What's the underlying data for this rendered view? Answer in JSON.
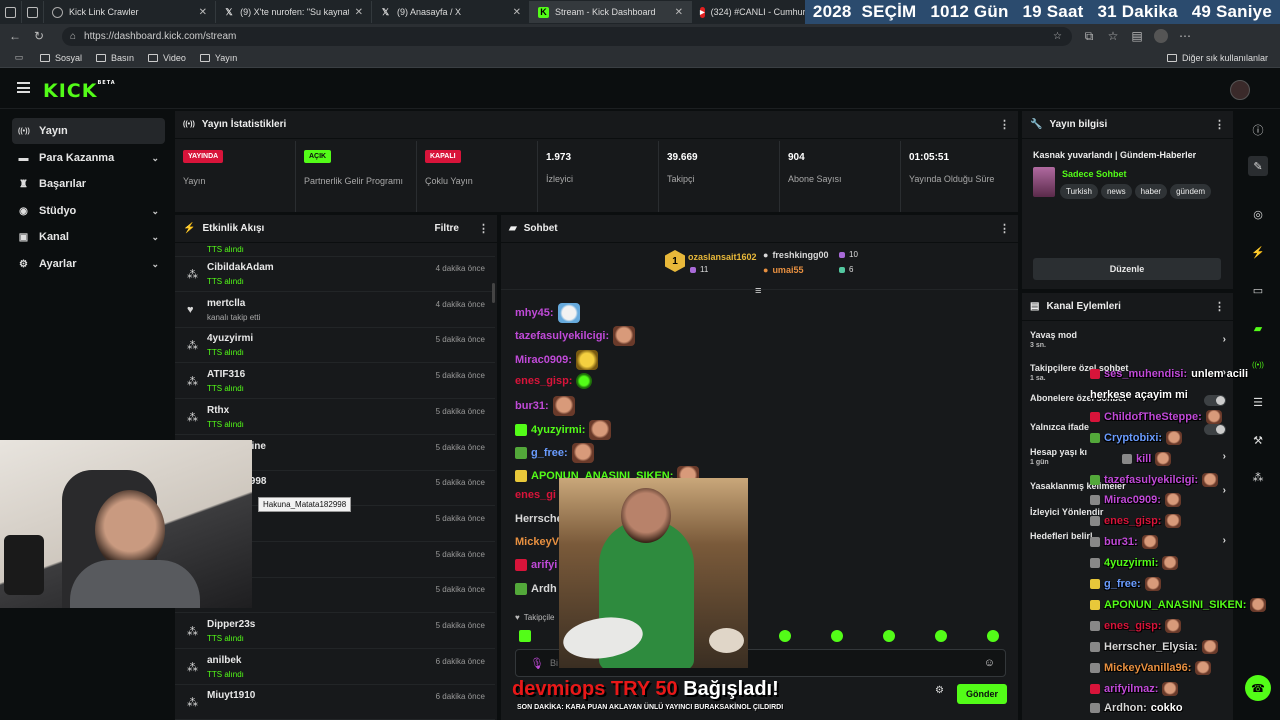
{
  "browser": {
    "tabs": [
      {
        "title": "Kick Link Crawler",
        "active": false
      },
      {
        "title": "(9) X'te nurofen: \"Su kaynatıp risk",
        "active": false
      },
      {
        "title": "(9) Anasayfa / X",
        "active": false
      },
      {
        "title": "Stream - Kick Dashboard",
        "active": true
      },
      {
        "title": "(324) #CANLI - Cumhurbaşk",
        "active": false
      }
    ],
    "url": "https://dashboard.kick.com/stream",
    "bookmarks": [
      "Sosyal",
      "Basın",
      "Video",
      "Yayın"
    ],
    "other_bookmarks": "Diğer sık kullanılanlar"
  },
  "countdown": {
    "year": "2028",
    "label": "SEÇİM",
    "days": "1012 Gün",
    "hours": "19 Saat",
    "minutes": "31 Dakika",
    "seconds": "49 Saniye"
  },
  "app": {
    "logo": "KICK",
    "logo_sup": "BETA"
  },
  "sidebar": {
    "items": [
      {
        "label": "Yayın",
        "icon": "broadcast-icon",
        "glyph": "((•))",
        "active": true,
        "expand": false
      },
      {
        "label": "Para Kazanma",
        "icon": "money-icon",
        "glyph": "▬",
        "active": false,
        "expand": true
      },
      {
        "label": "Başarılar",
        "icon": "trophy-icon",
        "glyph": "🏆",
        "active": false,
        "expand": false
      },
      {
        "label": "Stüdyo",
        "icon": "studio-icon",
        "glyph": "◉",
        "active": false,
        "expand": true
      },
      {
        "label": "Kanal",
        "icon": "channel-icon",
        "glyph": "▣",
        "active": false,
        "expand": true
      },
      {
        "label": "Ayarlar",
        "icon": "gear-icon",
        "glyph": "⚙",
        "active": false,
        "expand": true
      }
    ]
  },
  "stats": {
    "title": "Yayın İstatistikleri",
    "cells": [
      {
        "badge": "YAYINDA",
        "badge_color": "#d8143a",
        "label": "Yayın"
      },
      {
        "badge": "AÇIK",
        "badge_color": "#53fc18",
        "label": "Partnerlik Gelir Programı"
      },
      {
        "badge": "KAPALI",
        "badge_color": "#d8143a",
        "label": "Çoklu Yayın"
      },
      {
        "value": "1.973",
        "label": "İzleyici"
      },
      {
        "value": "39.669",
        "label": "Takipçi"
      },
      {
        "value": "904",
        "label": "Abone Sayısı"
      },
      {
        "value": "01:05:51",
        "label": "Yayında Olduğu Süre"
      }
    ]
  },
  "activity": {
    "title": "Etkinlik Akışı",
    "filter": "Filtre",
    "top_sub": "TTS alındı",
    "rows": [
      {
        "name": "CibildakAdam",
        "sub": "TTS alındı",
        "time": "4 dakika önce",
        "icon": "tts-icon"
      },
      {
        "name": "mertclla",
        "sub": "kanalı takip etti",
        "time": "4 dakika önce",
        "icon": "heart-icon"
      },
      {
        "name": "4yuzyirmi",
        "sub": "TTS alındı",
        "time": "5 dakika önce",
        "icon": "tts-icon"
      },
      {
        "name": "ATIF316",
        "sub": "TTS alındı",
        "time": "5 dakika önce",
        "icon": "tts-icon"
      },
      {
        "name": "Rthx",
        "sub": "TTS alındı",
        "time": "5 dakika önce",
        "icon": "tts-icon"
      },
      {
        "name": "nasicEngine",
        "sub": "",
        "time": "5 dakika önce",
        "icon": "tts-icon"
      },
      {
        "name": "latata182998",
        "sub": "",
        "time": "5 dakika önce",
        "icon": "tts-icon"
      },
      {
        "name": "l",
        "sub": "",
        "time": "5 dakika önce",
        "icon": "tts-icon"
      },
      {
        "name": "",
        "sub": "",
        "time": "5 dakika önce",
        "icon": "tts-icon"
      },
      {
        "name": "",
        "sub": "alındı",
        "time": "5 dakika önce",
        "icon": "tts-icon"
      },
      {
        "name": "Dipper23s",
        "sub": "TTS alındı",
        "time": "5 dakika önce",
        "icon": "tts-icon"
      },
      {
        "name": "anilbek",
        "sub": "TTS alındı",
        "time": "6 dakika önce",
        "icon": "tts-icon"
      },
      {
        "name": "Miuyt1910",
        "sub": "",
        "time": "6 dakika önce",
        "icon": "tts-icon"
      }
    ],
    "tooltip": "Hakuna_Matata182998"
  },
  "chat": {
    "title": "Sohbet",
    "leaders": [
      {
        "name": "ozaslansait1602",
        "count": "11",
        "color": "#e8b83a"
      },
      {
        "name": "freshkingg00",
        "count": "10",
        "color": "#d8d8d8"
      },
      {
        "name": "umai55",
        "count": "6",
        "color": "#e89040"
      }
    ],
    "messages": [
      {
        "user": "mhy45:",
        "color": "#c04ad8",
        "emote": "sheep"
      },
      {
        "user": "tazefasulyekilcigi:",
        "color": "#c04ad8",
        "emote": "face"
      },
      {
        "user": "Mirac0909:",
        "color": "#c04ad8",
        "emote": "yel"
      },
      {
        "user": "enes_gisp:",
        "color": "#d8143a",
        "emote": "green"
      },
      {
        "user": "bur31:",
        "color": "#c04ad8",
        "emote": "face"
      },
      {
        "user": "4yuzyirmi:",
        "color": "#53fc18",
        "emote": "face"
      },
      {
        "user": "g_free:",
        "color": "#6a9cff",
        "emote": "face"
      },
      {
        "user": "APONUN_ANASINI_SIKEN:",
        "color": "#53fc18",
        "emote": "face"
      },
      {
        "user": "enes_gi",
        "color": "#d8143a",
        "emote": ""
      },
      {
        "user": "Herrsche",
        "color": "#d8d8d8",
        "emote": ""
      },
      {
        "user": "MickeyV",
        "color": "#e89040",
        "emote": ""
      },
      {
        "user": "arifyi",
        "color": "#c04ad8",
        "emote": ""
      },
      {
        "user": "Ardh",
        "color": "#d8d8d8",
        "emote": ""
      }
    ],
    "followers_label": "Takipçile",
    "input_placeholder": "Bi",
    "send": "Gönder"
  },
  "donation": {
    "user": "devmiops",
    "amount": "TRY 50",
    "text": "Bağışladı!",
    "ticker": "SON DAKİKA: KARA PUAN AKLAYAN ÜNLÜ YAYINCI BURAKSAKİNOL ÇILDIRDI"
  },
  "stream_info": {
    "title": "Yayın bilgisi",
    "stream_title": "Kasnak yuvarlandı | Gündem-Haberler",
    "category": "Sadece Sohbet",
    "tags": [
      "Turkish",
      "news",
      "haber",
      "gündem"
    ],
    "edit": "Düzenle"
  },
  "channel_actions": {
    "title": "Kanal Eylemleri",
    "rows": [
      {
        "label": "Yavaş mod",
        "sub": "3 sn.",
        "control": "chevron"
      },
      {
        "label": "Takipçilere özel sohbet",
        "sub": "1 sa.",
        "control": "chevron"
      },
      {
        "label": "Abonelere özel sohbet",
        "sub": "",
        "control": "toggle"
      },
      {
        "label": "Yalnızca ifade",
        "sub": "",
        "control": "toggle"
      },
      {
        "label": "Hesap yaşı kı",
        "sub": "1 gün",
        "control": "chevron"
      },
      {
        "label": "Yasaklanmış kelimeler",
        "sub": "",
        "control": "chevron"
      },
      {
        "label": "İzleyici Yönlendir",
        "sub": "",
        "control": "none"
      },
      {
        "label": "Hedefleri belirl",
        "sub": "",
        "control": "chevron"
      }
    ]
  },
  "overlay_chat": [
    {
      "user": "ses_muhendisi:",
      "color": "#c04ad8",
      "text": "unlem acili"
    },
    {
      "user": "",
      "color": "#ffffff",
      "text": "herkese açayim mi"
    },
    {
      "user": "ChildofTheSteppe:",
      "color": "#c04ad8",
      "text": ""
    },
    {
      "user": "Cryptobixi:",
      "color": "#6a9cff",
      "text": ""
    },
    {
      "user": "kill",
      "color": "#c04ad8",
      "text": ""
    },
    {
      "user": "tazefasulyekilcigi:",
      "color": "#c04ad8",
      "text": ""
    },
    {
      "user": "Mirac0909:",
      "color": "#c04ad8",
      "text": ""
    },
    {
      "user": "enes_gisp:",
      "color": "#d8143a",
      "text": ""
    },
    {
      "user": "bur31:",
      "color": "#c04ad8",
      "text": ""
    },
    {
      "user": "4yuzyirmi:",
      "color": "#53fc18",
      "text": ""
    },
    {
      "user": "g_free:",
      "color": "#6a9cff",
      "text": ""
    },
    {
      "user": "APONUN_ANASINI_SIKEN:",
      "color": "#53fc18",
      "text": ""
    },
    {
      "user": "enes_gisp:",
      "color": "#d8143a",
      "text": ""
    },
    {
      "user": "Herrscher_Elysia:",
      "color": "#d8d8d8",
      "text": ""
    },
    {
      "user": "MickeyVanilla96:",
      "color": "#e89040",
      "text": ""
    },
    {
      "user": "arifyilmaz:",
      "color": "#c04ad8",
      "text": ""
    },
    {
      "user": "Ardhon:",
      "color": "#d8d8d8",
      "text": "cokko"
    }
  ]
}
